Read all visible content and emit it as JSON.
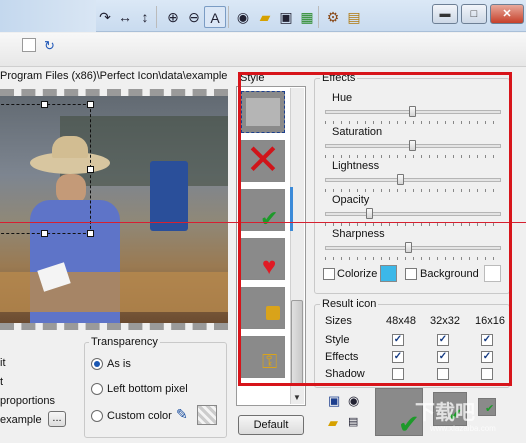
{
  "window": {
    "minimize_label": "▬",
    "maximize_label": "□",
    "close_label": "✕"
  },
  "toolbar": {
    "icons": [
      "rotate-icon",
      "flip-horizontal-icon",
      "flip-vertical-icon",
      "zoom-in-icon",
      "zoom-out-icon",
      "text-tool-icon",
      "preview-eye-icon",
      "folder-icon",
      "save-icon",
      "palette-icon",
      "settings-icon",
      "book-icon"
    ]
  },
  "file_path": "Program Files (x86)\\Perfect Icon\\data\\example.jpg",
  "left_panel": {
    "labels": [
      "it",
      "t",
      "proportions",
      "example"
    ],
    "browse_label": "...",
    "transparency": {
      "title": "Transparency",
      "options": [
        "As is",
        "Left bottom pixel",
        "Custom color"
      ],
      "selected": "As is"
    }
  },
  "style": {
    "title": "Style",
    "default_button": "Default"
  },
  "effects": {
    "title": "Effects",
    "sliders": [
      {
        "label": "Hue",
        "value": 0.5
      },
      {
        "label": "Saturation",
        "value": 0.5
      },
      {
        "label": "Lightness",
        "value": 0.42
      },
      {
        "label": "Opacity",
        "value": 0.25
      },
      {
        "label": "Sharpness",
        "value": 0.48
      }
    ],
    "colorize_label": "Colorize",
    "colorize_color": "#3cb8e8",
    "background_label": "Background",
    "background_color": "#ffffff"
  },
  "result_icon": {
    "title": "Result icon",
    "sizes_label": "Sizes",
    "sizes": [
      "48x48",
      "32x32",
      "16x16"
    ],
    "rows": [
      {
        "label": "Style",
        "checks": [
          true,
          true,
          true
        ]
      },
      {
        "label": "Effects",
        "checks": [
          true,
          true,
          true
        ]
      },
      {
        "label": "Shadow",
        "checks": [
          false,
          false,
          false
        ]
      }
    ]
  },
  "watermark": {
    "text": "下载吧",
    "sub": "www.xiazaiba.com"
  }
}
